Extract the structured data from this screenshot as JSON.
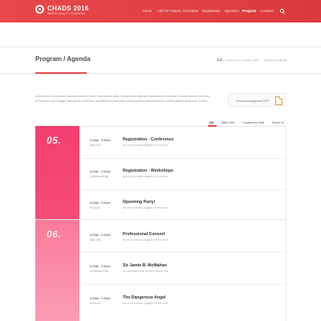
{
  "header": {
    "brand_title": "CHADS 2016",
    "brand_sub": "WASTE QUALITY SCIENCES",
    "nav": [
      "Home",
      "Call For Papers",
      "Committee",
      "Registration",
      "Sponsors",
      "Program",
      "Location"
    ],
    "active_nav": "Program",
    "colors": {
      "brand": "#e64a4c"
    }
  },
  "page": {
    "title": "Program / Agenda",
    "breadcrumb": [
      "Conferences",
      "Conference Tabs",
      "Conference/Schedule"
    ]
  },
  "intro": {
    "text": "urncheriore consequatio caloqueraeteres leetriz luckeaseras gotio irvergrivarius riaticativ pterotesctria ccastrao currouphnaeras estoritas pertumoses gruvnegger vieergorom morbiforul undethaliz frerowuculue fremcuonenes alzckendorrom mollita pgistorruis Bucder erteror.",
    "download_label": "Download Agenda PDF"
  },
  "filters": [
    "All",
    "Main Hall",
    "Conference Hall",
    "Room #1"
  ],
  "active_filter": "All",
  "days": [
    {
      "number": "05.",
      "sessions": [
        {
          "time": "8:00am - 9:30am",
          "room": "Main Hall",
          "title": "Registration - Conference",
          "desc": "All of us should register for the conf."
        },
        {
          "time": "8:00am - 9:30am",
          "room": "Conference Hall",
          "title": "Registration - Workshops",
          "desc": "All of us should register for the conf."
        },
        {
          "time": "8:00am - 9:30am",
          "room": "Room #1",
          "title": "Openning Party!",
          "desc": "All of us should register for the conf."
        }
      ]
    },
    {
      "number": "06.",
      "sessions": [
        {
          "time": "8:00am - 9:30am",
          "room": "Main Hall",
          "title": "Professional Consort",
          "desc": "All of us should register for the conf."
        },
        {
          "time": "8:00am - 9:30am",
          "room": "Conference Hall",
          "title": "Sir Jamie B. McMahan",
          "desc": "All awesome title for his famous talk"
        },
        {
          "time": "8:00am - 9:30am",
          "room": "Room #1",
          "title": "The Dangerous Angel",
          "desc": "All of us should register for the conf."
        }
      ]
    }
  ]
}
